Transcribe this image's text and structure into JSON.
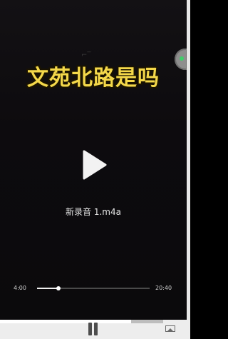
{
  "overlay": {
    "caption": "文苑北路是吗"
  },
  "player": {
    "file_name": "新录音 1.m4a",
    "current_time": "4:00",
    "total_time": "20:40",
    "progress_fraction": 0.19,
    "play_icon": "play-icon"
  },
  "bottom_bar": {
    "progress_fraction": 0.69,
    "pause_icon": "pause-icon",
    "screen_icon": "screen-mirror-icon"
  },
  "colors": {
    "caption_yellow": "#f4d84a",
    "background": "#0b0a0c",
    "side_handle_dot": "#3fcf6a"
  }
}
